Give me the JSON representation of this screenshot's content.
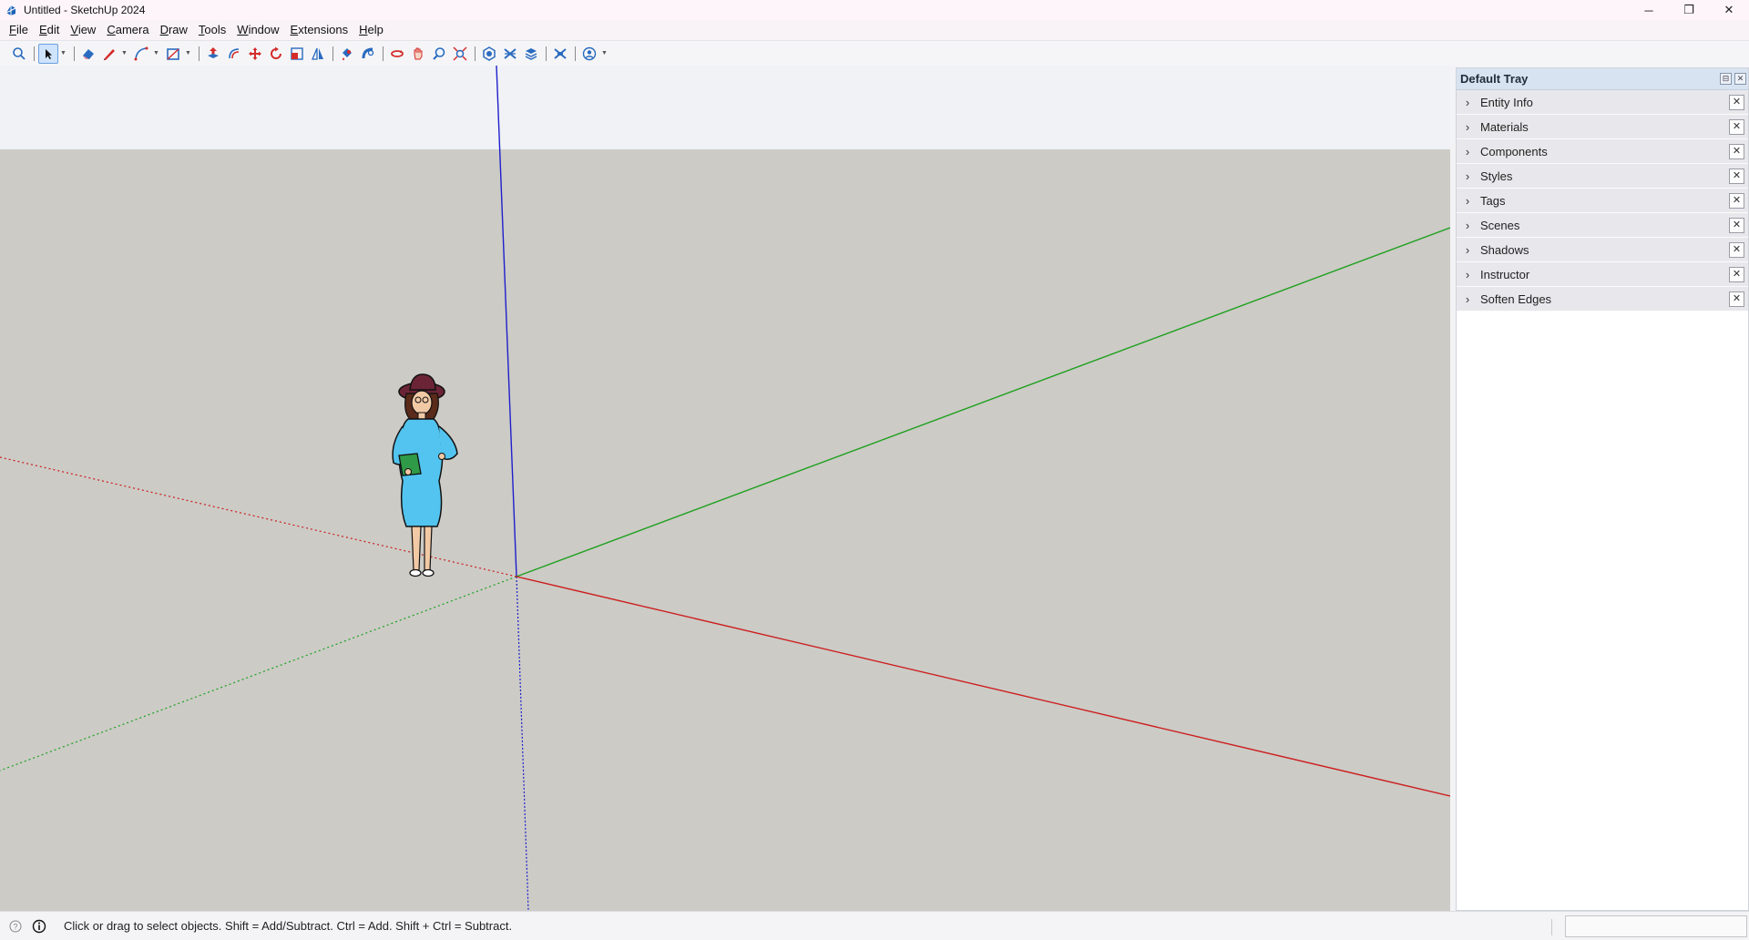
{
  "window": {
    "title": "Untitled - SketchUp 2024",
    "controls": [
      "minimize-icon",
      "restore-icon",
      "close-icon"
    ],
    "minimize_glyph": "─",
    "restore_glyph": "❐",
    "close_glyph": "✕"
  },
  "menu": {
    "items": [
      {
        "first": "F",
        "rest": "ile"
      },
      {
        "first": "E",
        "rest": "dit"
      },
      {
        "first": "V",
        "rest": "iew"
      },
      {
        "first": "C",
        "rest": "amera"
      },
      {
        "first": "D",
        "rest": "raw"
      },
      {
        "first": "T",
        "rest": "ools"
      },
      {
        "first": "W",
        "rest": "indow"
      },
      {
        "first": "E",
        "rest": "xtensions"
      },
      {
        "first": "H",
        "rest": "elp"
      }
    ]
  },
  "toolbar": {
    "tools": [
      "search-icon",
      "select-arrow-icon",
      "eraser-icon",
      "pencil-line-icon",
      "arc-icon",
      "rectangle-icon",
      "push-pull-icon",
      "offset-icon",
      "move-icon",
      "rotate-icon",
      "scale-icon",
      "flip-icon",
      "paint-bucket-icon",
      "follow-me-icon",
      "orbit-icon",
      "pan-icon",
      "zoom-icon",
      "zoom-extents-icon",
      "3d-warehouse-icon",
      "extension-warehouse-icon",
      "layout-icon",
      "section-plane-icon",
      "account-icon"
    ],
    "accent": "#1a73e8",
    "tool_red": "#d42b2b"
  },
  "viewport": {
    "sky_color": "#f0f2f5",
    "ground_color": "#cccbc6",
    "axis_colors": {
      "red": "#cc1f1f",
      "green": "#1ea01e",
      "blue": "#1f1fcc"
    }
  },
  "tray": {
    "title": "Default Tray",
    "pin_glyph": "⊟",
    "close_glyph": "✕",
    "panels": [
      {
        "label": "Entity Info"
      },
      {
        "label": "Materials"
      },
      {
        "label": "Components"
      },
      {
        "label": "Styles"
      },
      {
        "label": "Tags"
      },
      {
        "label": "Scenes"
      },
      {
        "label": "Shadows"
      },
      {
        "label": "Instructor"
      },
      {
        "label": "Soften Edges"
      }
    ],
    "chevron_glyph": "›",
    "panel_close_glyph": "✕"
  },
  "status": {
    "message": "Click or drag to select objects. Shift = Add/Subtract. Ctrl = Add. Shift + Ctrl = Subtract.",
    "measurements_value": ""
  }
}
